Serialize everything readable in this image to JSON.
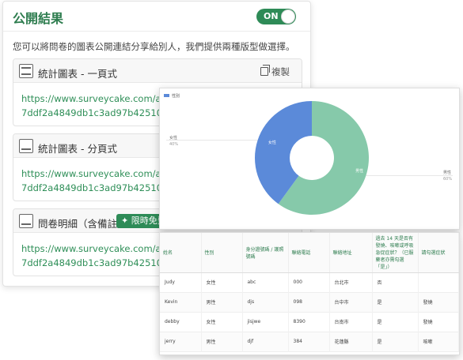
{
  "panel": {
    "title": "公開結果",
    "toggle_label": "ON",
    "description": "您可以將問卷的圖表公開連結分享給別人，我們提供兩種版型做選擇。",
    "copy_label": "複製",
    "cards": [
      {
        "title": "統計圖表 - 一頁式",
        "url_line1": "https://www.surveycake.com/admin/t",
        "url_line2": "7ddf2a4849db1c3ad97b42510b3&lay",
        "has_copy": true
      },
      {
        "title": "統計圖表 - 分頁式",
        "url_line1": "https://www.surveycake.com/admin/t",
        "url_line2": "7ddf2a4849db1c3ad97b42510b3"
      },
      {
        "title": "問卷明細（含備註）",
        "badge": "限時免費",
        "url_line1": "https://www.surveycake.com/admin/t",
        "url_line2": "7ddf2a4849db1c3ad97b42510b3"
      }
    ]
  },
  "chart_data": {
    "type": "pie",
    "title": "",
    "legend": [
      "性別"
    ],
    "categories": [
      "女性",
      "男性"
    ],
    "values": [
      40,
      60
    ],
    "percent_labels": [
      "40%",
      "60%"
    ],
    "colors": [
      "#5b8ad9",
      "#86c9aa"
    ],
    "donut": true
  },
  "table": {
    "headers": [
      "姓名",
      "性別",
      "身分證號碼 / 護照號碼",
      "聯絡電話",
      "聯絡地址",
      "過去 14 天是否有發燒、咳嗽或呼吸急促症狀？（已服藥者亦需勾選「是」）",
      "請勾選症狀"
    ],
    "rows": [
      [
        "Judy",
        "女性",
        "abc",
        "000",
        "台北市",
        "否",
        ""
      ],
      [
        "Kevin",
        "男性",
        "djs",
        "098",
        "台中市",
        "是",
        "發燒"
      ],
      [
        "debby",
        "女性",
        "jisjwe",
        "8390",
        "台南市",
        "是",
        "發燒"
      ],
      [
        "jerry",
        "男性",
        "djf",
        "384",
        "花蓮縣",
        "是",
        "咳嗽"
      ]
    ]
  },
  "colors": {
    "accent": "#2e8b57",
    "link": "#2f8f58",
    "female": "#5b8ad9",
    "male": "#86c9aa"
  }
}
